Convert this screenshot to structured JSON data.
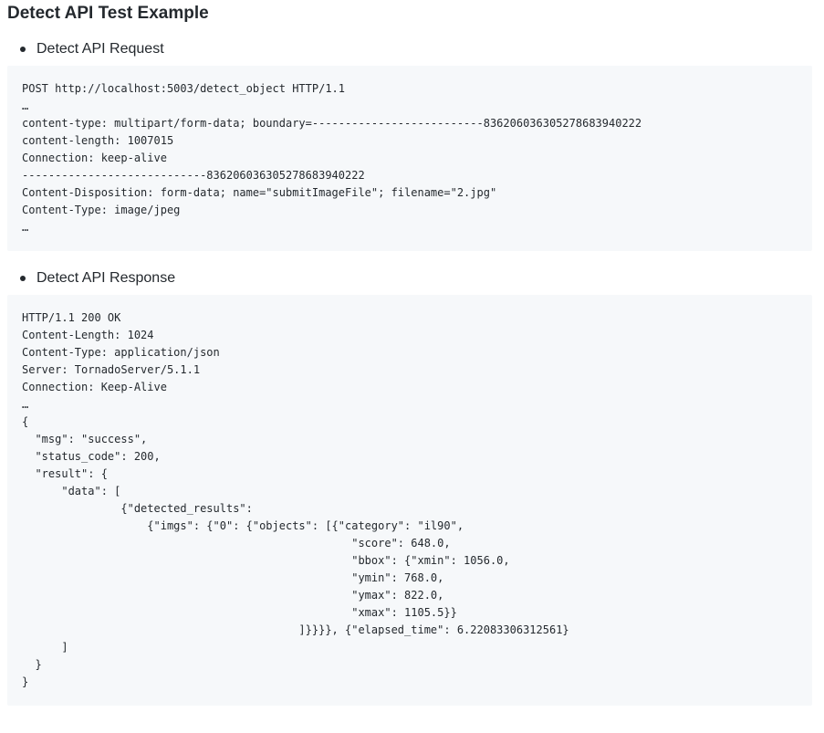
{
  "page": {
    "title": "Detect API Test Example"
  },
  "sections": [
    {
      "bullet": "Detect API Request",
      "code": "POST http://localhost:5003/detect_object HTTP/1.1\n…\ncontent-type: multipart/form-data; boundary=--------------------------836206036305278683940222\ncontent-length: 1007015\nConnection: keep-alive\n----------------------------836206036305278683940222\nContent-Disposition: form-data; name=\"submitImageFile\"; filename=\"2.jpg\"\nContent-Type: image/jpeg\n…"
    },
    {
      "bullet": "Detect API Response",
      "code": "HTTP/1.1 200 OK\nContent-Length: 1024\nContent-Type: application/json\nServer: TornadoServer/5.1.1\nConnection: Keep-Alive\n…\n{\n  \"msg\": \"success\",\n  \"status_code\": 200,\n  \"result\": {\n      \"data\": [\n               {\"detected_results\":\n                   {\"imgs\": {\"0\": {\"objects\": [{\"category\": \"il90\",\n                                                  \"score\": 648.0,\n                                                  \"bbox\": {\"xmin\": 1056.0,\n                                                  \"ymin\": 768.0,\n                                                  \"ymax\": 822.0,\n                                                  \"xmax\": 1105.5}}\n                                          ]}}}}, {\"elapsed_time\": 6.22083306312561}\n      ]\n  }\n}"
    }
  ]
}
